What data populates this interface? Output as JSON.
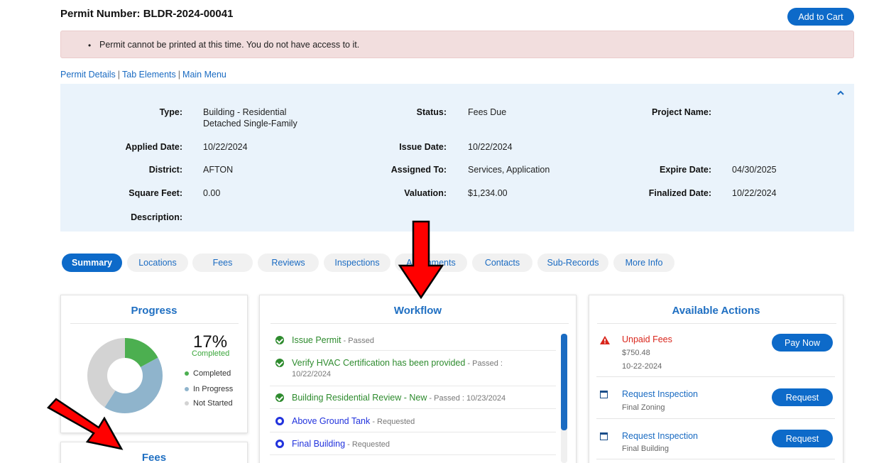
{
  "header": {
    "permit_number": "Permit Number: BLDR-2024-00041",
    "add_to_cart": "Add to Cart"
  },
  "alert": {
    "message": "Permit cannot be printed at this time. You do not have access to it."
  },
  "links": {
    "permit_details": "Permit Details",
    "tab_elements": "Tab Elements",
    "main_menu": "Main Menu",
    "separator": "|"
  },
  "details": {
    "type_label": "Type:",
    "type_value_line1": "Building - Residential",
    "type_value_line2": "Detached Single-Family",
    "status_label": "Status:",
    "status_value": "Fees Due",
    "project_name_label": "Project Name:",
    "applied_date_label": "Applied Date:",
    "applied_date_value": "10/22/2024",
    "issue_date_label": "Issue Date:",
    "issue_date_value": "10/22/2024",
    "district_label": "District:",
    "district_value": "AFTON",
    "assigned_to_label": "Assigned To:",
    "assigned_to_value": "Services, Application",
    "expire_date_label": "Expire Date:",
    "expire_date_value": "04/30/2025",
    "square_feet_label": "Square Feet:",
    "square_feet_value": "0.00",
    "valuation_label": "Valuation:",
    "valuation_value": "$1,234.00",
    "finalized_date_label": "Finalized Date:",
    "finalized_date_value": "10/22/2024",
    "description_label": "Description:"
  },
  "tabs": [
    {
      "label": "Summary",
      "active": true
    },
    {
      "label": "Locations",
      "active": false
    },
    {
      "label": "Fees",
      "active": false
    },
    {
      "label": "Reviews",
      "active": false
    },
    {
      "label": "Inspections",
      "active": false
    },
    {
      "label": "Attachments",
      "active": false
    },
    {
      "label": "Contacts",
      "active": false
    },
    {
      "label": "Sub-Records",
      "active": false
    },
    {
      "label": "More Info",
      "active": false
    }
  ],
  "progress": {
    "title": "Progress",
    "percent": "17%",
    "percent_label": "Completed",
    "legend": [
      {
        "label": "Completed",
        "color": "#4caf50",
        "fraction": 0.17
      },
      {
        "label": "In Progress",
        "color": "#8fb4cc",
        "fraction": 0.42
      },
      {
        "label": "Not Started",
        "color": "#d3d3d3",
        "fraction": 0.41
      }
    ]
  },
  "fees_card": {
    "title": "Fees"
  },
  "workflow": {
    "title": "Workflow",
    "items": [
      {
        "name": "Issue Permit",
        "status": " - Passed",
        "state": "done"
      },
      {
        "name": "Verify HVAC Certification has been provided",
        "status": " - Passed :",
        "date": "10/22/2024",
        "state": "done"
      },
      {
        "name": "Building Residential Review - New",
        "status": " - Passed : 10/23/2024",
        "state": "done"
      },
      {
        "name": "Above Ground Tank",
        "status": " - Requested",
        "state": "requested"
      },
      {
        "name": "Final Building",
        "status": " - Requested",
        "state": "requested"
      }
    ]
  },
  "actions": {
    "title": "Available Actions",
    "items": [
      {
        "title": "Unpaid Fees",
        "line1": "$750.48",
        "line2": "10-22-2024",
        "button": "Pay Now"
      },
      {
        "title": "Request Inspection",
        "line1": "Final Zoning",
        "button": "Request"
      },
      {
        "title": "Request Inspection",
        "line1": "Final Building",
        "button": "Request"
      }
    ]
  },
  "colors": {
    "primary": "#0d6ac9",
    "link": "#1a6bc2",
    "alert_bg": "#f2dede",
    "details_bg": "#eaf3fb",
    "annotation_arrow": "#ff0000"
  }
}
